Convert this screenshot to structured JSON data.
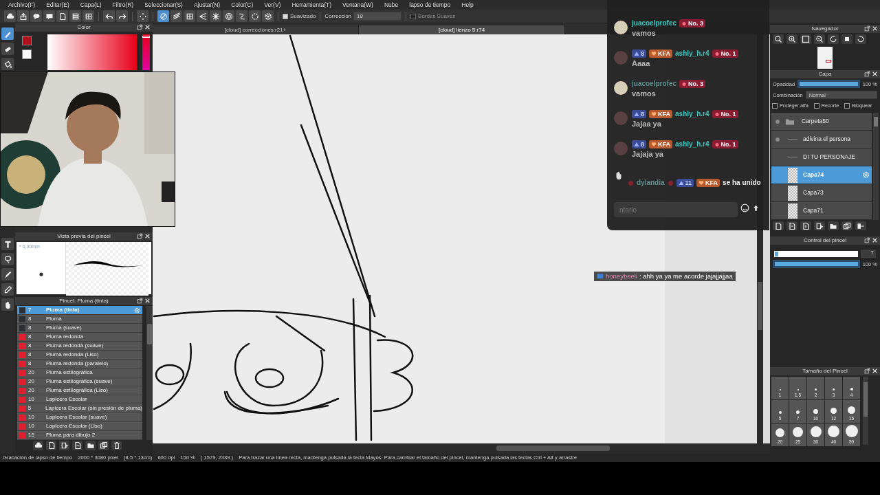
{
  "menu": [
    "Archivo(F)",
    "Editar(E)",
    "Capa(L)",
    "Filtro(R)",
    "Seleccionar(S)",
    "Ajustar(N)",
    "Color(C)",
    "Ver(V)",
    "Herramienta(T)",
    "Ventana(W)",
    "Nube",
    "lapso de tiempo",
    "Help"
  ],
  "command_bar": [
    {
      "kind": "cloud"
    },
    {
      "kind": "export"
    },
    {
      "kind": "bubble"
    },
    {
      "kind": "comment"
    },
    {
      "kind": "page"
    },
    {
      "kind": "list"
    },
    {
      "kind": "grid"
    },
    {
      "kind": "undo"
    },
    {
      "kind": "redo"
    },
    {
      "kind": "spinner"
    }
  ],
  "ruler_tools": [
    {
      "kind": "no-ruler",
      "selected": true
    },
    {
      "kind": "parallel",
      "selected": false
    },
    {
      "kind": "grid",
      "selected": false
    },
    {
      "kind": "perspective",
      "selected": false
    },
    {
      "kind": "radial",
      "selected": false
    },
    {
      "kind": "concentric",
      "selected": false
    },
    {
      "kind": "curve",
      "selected": false
    },
    {
      "kind": "ellipse",
      "selected": false
    },
    {
      "kind": "gear",
      "selected": false
    }
  ],
  "tool_options": {
    "smoothing": {
      "label": "Suavizado",
      "checked": true
    },
    "correction": {
      "label": "Corrección",
      "value": "18"
    },
    "soft_edges": {
      "label": "Bordes Suaves",
      "checked": false,
      "disabled": true
    }
  },
  "tools": [
    {
      "kind": "pen",
      "selected": true
    },
    {
      "kind": "eraser",
      "selected": false
    },
    {
      "kind": "fill",
      "selected": false
    },
    {
      "kind": "text",
      "selected": false
    },
    {
      "kind": "lasso",
      "selected": false
    },
    {
      "kind": "brush",
      "selected": false
    },
    {
      "kind": "eyedropper",
      "selected": false
    },
    {
      "kind": "hand",
      "selected": false
    }
  ],
  "color_panel": {
    "title": "Color",
    "hue": {
      "level": 0.04
    }
  },
  "brush_preview": {
    "title": "Vista previa del pincel",
    "size": "* 0.30mm"
  },
  "brush_list": {
    "title": "Pincel: Pluma (tinta)",
    "items": [
      {
        "size": "7",
        "name": "Pluma (tinta)",
        "color": "#2b2f36",
        "selected": true
      },
      {
        "size": "8",
        "name": "Pluma",
        "color": "#2b2f36",
        "selected": false
      },
      {
        "size": "8",
        "name": "Pluma (suave)",
        "color": "#2b2f36",
        "selected": false
      },
      {
        "size": "8",
        "name": "Pluma redonda",
        "color": "#e0202e",
        "selected": false
      },
      {
        "size": "8",
        "name": "Pluma redonda (suave)",
        "color": "#e0202e",
        "selected": false
      },
      {
        "size": "8",
        "name": "Pluma redonda (Liso)",
        "color": "#e0202e",
        "selected": false
      },
      {
        "size": "8",
        "name": "Pluma redonda (paralelo)",
        "color": "#e0202e",
        "selected": false
      },
      {
        "size": "20",
        "name": "Pluma estilográfica",
        "color": "#e0202e",
        "selected": false
      },
      {
        "size": "20",
        "name": "Pluma estilográfica (suave)",
        "color": "#e0202e",
        "selected": false
      },
      {
        "size": "20",
        "name": "Pluma estilográfica (Liso)",
        "color": "#e0202e",
        "selected": false
      },
      {
        "size": "10",
        "name": "Lapicera Escolar",
        "color": "#e0202e",
        "selected": false
      },
      {
        "size": "5",
        "name": "Lapicera Escolar (sin presión de pluma)",
        "color": "#e0202e",
        "selected": false
      },
      {
        "size": "10",
        "name": "Lapicera Escolar (suave)",
        "color": "#e0202e",
        "selected": false
      },
      {
        "size": "10",
        "name": "Lapicera Escolar (Liso)",
        "color": "#e0202e",
        "selected": false
      },
      {
        "size": "15",
        "name": "Pluma para dibujo 2",
        "color": "#e0202e",
        "selected": false
      }
    ]
  },
  "canvas_tabs": [
    {
      "label": "[cloud] correcciones:r21+",
      "selected": false
    },
    {
      "label": "[cloud] lienzo 5:r74",
      "selected": true
    }
  ],
  "chat": {
    "messages": [
      {
        "kind": "message",
        "color": "#d8cfb8",
        "user": "juacoelprofec",
        "user_faded": false,
        "badges_after": [
          {
            "kind": "rank",
            "text": "No. 3"
          }
        ],
        "text": "vamos"
      },
      {
        "kind": "message",
        "color": "#5a4040",
        "badges_before": [
          {
            "kind": "level",
            "text": "8"
          },
          {
            "kind": "fan",
            "text": "KFA"
          }
        ],
        "user": "ashly_h.r4",
        "user_faded": false,
        "badges_after": [
          {
            "kind": "rank",
            "text": "No. 1"
          }
        ],
        "text": "Aaaa"
      },
      {
        "kind": "message",
        "color": "#d8cfb8",
        "user": "juacoelprofec",
        "user_faded": true,
        "badges_after": [
          {
            "kind": "rank",
            "text": "No. 3"
          }
        ],
        "text": "vamos"
      },
      {
        "kind": "message",
        "color": "#5a4040",
        "badges_before": [
          {
            "kind": "level",
            "text": "8"
          },
          {
            "kind": "fan",
            "text": "KFA"
          }
        ],
        "user": "ashly_h.r4",
        "user_faded": false,
        "badges_after": [
          {
            "kind": "rank",
            "text": "No. 1"
          }
        ],
        "text": "Jajaa ya"
      },
      {
        "kind": "message",
        "color": "#5a4040",
        "badges_before": [
          {
            "kind": "level",
            "text": "8"
          },
          {
            "kind": "fan",
            "text": "KFA"
          }
        ],
        "user": "ashly_h.r4",
        "user_faded": false,
        "badges_after": [
          {
            "kind": "rank",
            "text": "No. 1"
          }
        ],
        "text": "Jajaja ya"
      },
      {
        "kind": "join",
        "user": "dylandia",
        "user_faded": true,
        "badges_after": [
          {
            "kind": "level",
            "text": "11"
          },
          {
            "kind": "fan",
            "text": "KFA"
          }
        ],
        "text": "se ha unido"
      }
    ],
    "comment_placeholder": "ntario"
  },
  "overlay_comment": {
    "user": "honeybeeli",
    "text": ": ahh ya ya me acorde jajajjajjaa"
  },
  "navigator": {
    "title": "Navegador"
  },
  "layers": {
    "title": "Capa",
    "opacity": {
      "label": "Opacidad",
      "level": 1.0,
      "value": "100 %"
    },
    "blend_label": "Combinación",
    "blend_value": "Normal",
    "options": [
      {
        "label": "Proteger alfa",
        "checked": false
      },
      {
        "label": "Recorte",
        "checked": false
      },
      {
        "label": "Bloquear",
        "checked": false
      }
    ],
    "items": [
      {
        "kind": "folder",
        "name": "Carpeta50",
        "visible": true,
        "selected": false,
        "children": [
          {
            "kind": "text",
            "name": "adivina el persona",
            "visible": true,
            "selected": false
          },
          {
            "kind": "text",
            "name": "DI TU PERSONAJE",
            "visible": false,
            "selected": false
          },
          {
            "kind": "raster",
            "name": "Capa74",
            "visible": false,
            "selected": true
          },
          {
            "kind": "raster",
            "name": "Capa73",
            "visible": false,
            "selected": false
          },
          {
            "kind": "raster",
            "name": "Capa71",
            "visible": false,
            "selected": false
          }
        ]
      }
    ]
  },
  "brush_control": {
    "title": "Control del pincel",
    "size": {
      "level": 0.06,
      "value": "7"
    },
    "opacity": {
      "level": 1.0,
      "value": "100 %"
    }
  },
  "brush_size": {
    "title": "Tamaño del Pincel",
    "sizes": [
      "1",
      "1.5",
      "2",
      "3",
      "4",
      "5",
      "7",
      "10",
      "12",
      "15",
      "20",
      "25",
      "30",
      "40",
      "50"
    ]
  },
  "status_bar": [
    "Grabación de lapso de tiempo",
    "2000 * 3080 pixel",
    "(8.5 * 13cm)",
    "600 dpi",
    "150 %",
    "( 1579, 2339 )",
    "Para trazar una línea recta, mantenga pulsada la tecla Mayús. Para cambiar el tamaño del pincel, mantenga pulsada las teclas Ctrl + Alt y arrastre"
  ]
}
